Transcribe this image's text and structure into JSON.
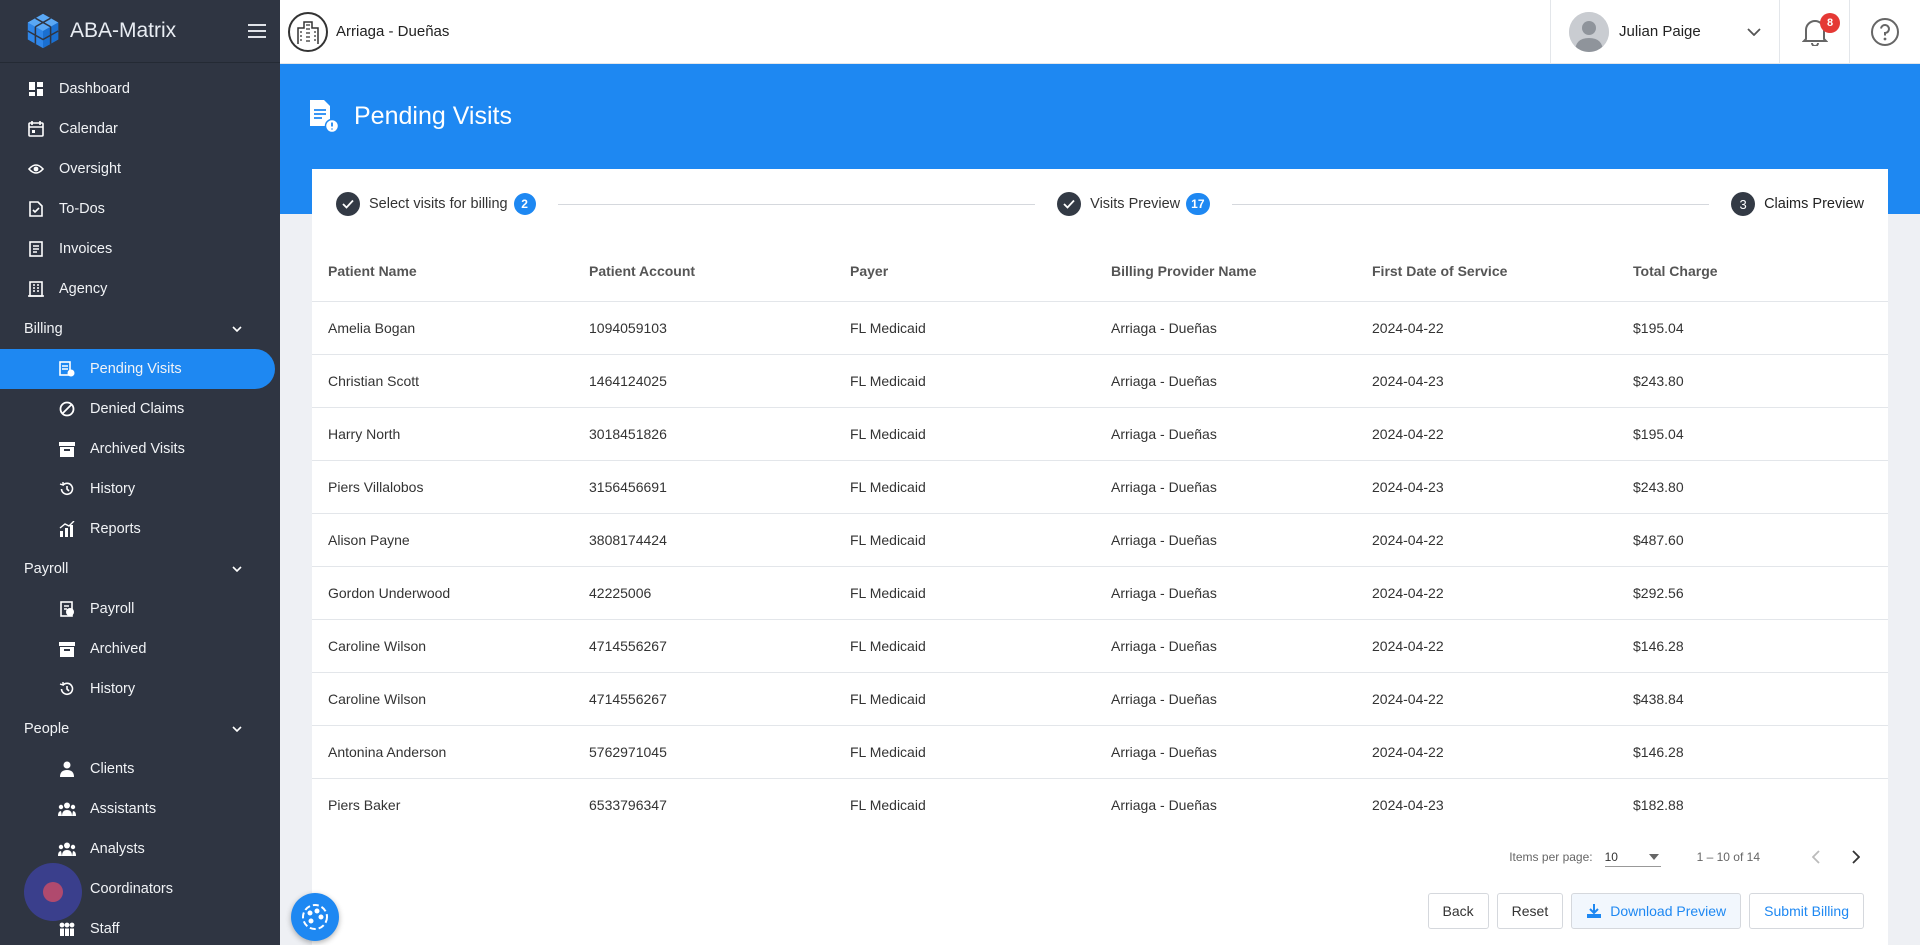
{
  "app": {
    "name": "ABA-Matrix"
  },
  "sidebar": {
    "top_items": [
      {
        "label": "Dashboard",
        "icon": "dashboard-icon"
      },
      {
        "label": "Calendar",
        "icon": "calendar-icon"
      },
      {
        "label": "Oversight",
        "icon": "eye-icon"
      },
      {
        "label": "To-Dos",
        "icon": "todo-icon"
      },
      {
        "label": "Invoices",
        "icon": "invoice-icon"
      },
      {
        "label": "Agency",
        "icon": "agency-icon"
      }
    ],
    "billing": {
      "label": "Billing",
      "items": [
        {
          "label": "Pending Visits",
          "icon": "pending-visits-icon",
          "active": true
        },
        {
          "label": "Denied Claims",
          "icon": "denied-icon"
        },
        {
          "label": "Archived Visits",
          "icon": "archive-icon"
        },
        {
          "label": "History",
          "icon": "history-icon"
        },
        {
          "label": "Reports",
          "icon": "reports-icon"
        }
      ]
    },
    "payroll": {
      "label": "Payroll",
      "items": [
        {
          "label": "Payroll",
          "icon": "payroll-icon"
        },
        {
          "label": "Archived",
          "icon": "archive-icon"
        },
        {
          "label": "History",
          "icon": "history-icon"
        }
      ]
    },
    "people": {
      "label": "People",
      "items": [
        {
          "label": "Clients",
          "icon": "person-icon"
        },
        {
          "label": "Assistants",
          "icon": "group-icon"
        },
        {
          "label": "Analysts",
          "icon": "group-icon"
        },
        {
          "label": "Coordinators",
          "icon": "group-icon"
        },
        {
          "label": "Staff",
          "icon": "staff-icon"
        }
      ]
    }
  },
  "topbar": {
    "org_name": "Arriaga - Dueñas",
    "user_name": "Julian Paige",
    "notification_count": "8"
  },
  "page": {
    "title": "Pending Visits"
  },
  "stepper": {
    "steps": [
      {
        "label": "Select visits for billing",
        "count": "2",
        "state": "done"
      },
      {
        "label": "Visits Preview",
        "count": "17",
        "state": "done"
      },
      {
        "label": "Claims Preview",
        "number": "3",
        "state": "current"
      }
    ]
  },
  "table": {
    "headers": [
      "Patient Name",
      "Patient Account",
      "Payer",
      "Billing Provider Name",
      "First Date of Service",
      "Total Charge"
    ],
    "rows": [
      [
        "Amelia Bogan",
        "1094059103",
        "FL Medicaid",
        "Arriaga - Dueñas",
        "2024-04-22",
        "$195.04"
      ],
      [
        "Christian Scott",
        "1464124025",
        "FL Medicaid",
        "Arriaga - Dueñas",
        "2024-04-23",
        "$243.80"
      ],
      [
        "Harry North",
        "3018451826",
        "FL Medicaid",
        "Arriaga - Dueñas",
        "2024-04-22",
        "$195.04"
      ],
      [
        "Piers Villalobos",
        "3156456691",
        "FL Medicaid",
        "Arriaga - Dueñas",
        "2024-04-23",
        "$243.80"
      ],
      [
        "Alison Payne",
        "3808174424",
        "FL Medicaid",
        "Arriaga - Dueñas",
        "2024-04-22",
        "$487.60"
      ],
      [
        "Gordon Underwood",
        "42225006",
        "FL Medicaid",
        "Arriaga - Dueñas",
        "2024-04-22",
        "$292.56"
      ],
      [
        "Caroline Wilson",
        "4714556267",
        "FL Medicaid",
        "Arriaga - Dueñas",
        "2024-04-22",
        "$146.28"
      ],
      [
        "Caroline Wilson",
        "4714556267",
        "FL Medicaid",
        "Arriaga - Dueñas",
        "2024-04-22",
        "$438.84"
      ],
      [
        "Antonina Anderson",
        "5762971045",
        "FL Medicaid",
        "Arriaga - Dueñas",
        "2024-04-22",
        "$146.28"
      ],
      [
        "Piers Baker",
        "6533796347",
        "FL Medicaid",
        "Arriaga - Dueñas",
        "2024-04-23",
        "$182.88"
      ]
    ]
  },
  "pagination": {
    "items_per_page_label": "Items per page:",
    "items_per_page": "10",
    "range": "1 – 10 of 14"
  },
  "actions": {
    "back": "Back",
    "reset": "Reset",
    "download": "Download Preview",
    "submit": "Submit Billing"
  },
  "colors": {
    "primary": "#1e88f2",
    "sidebar": "#2f3542",
    "badge": "#e53935"
  }
}
